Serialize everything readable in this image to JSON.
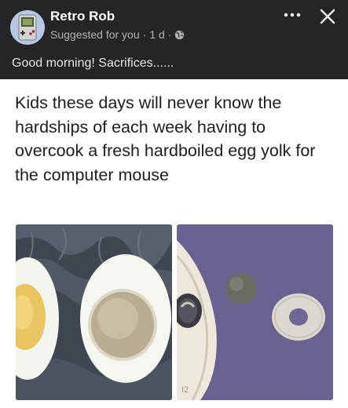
{
  "post": {
    "author": "Retro Rob",
    "meta": {
      "suggested": "Suggested for you",
      "separator": "·",
      "time": "1 d",
      "audience_icon": "globe-icon"
    },
    "caption": "Good morning! Sacrifices......",
    "more_icon": "more-options-icon",
    "close_icon": "close-icon"
  },
  "card": {
    "text": "Kids these days will never know the hardships of each week having to overcook a fresh hardboiled egg yolk for the computer mouse",
    "images": [
      {
        "name": "boiled-egg-halves-image"
      },
      {
        "name": "mouse-ball-image"
      }
    ]
  },
  "colors": {
    "header_bg": "#242526",
    "header_text": "#ffffff",
    "meta_text": "#b0b3b8",
    "body_text": "#1c1e21",
    "page_bg": "#ffffff"
  }
}
